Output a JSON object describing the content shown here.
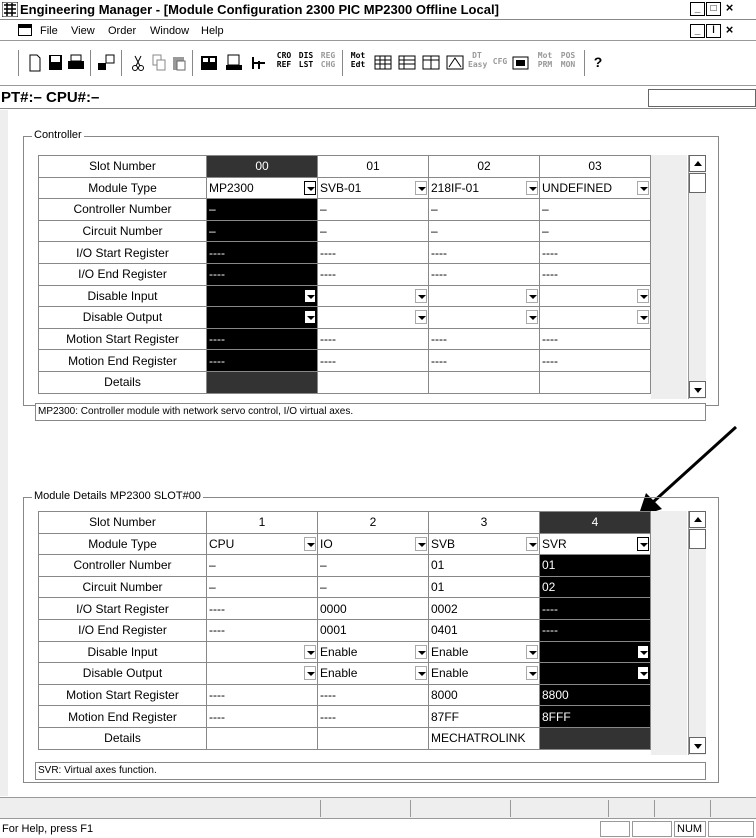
{
  "window": {
    "title": "Engineering Manager - [Module Configuration   2300 PIC MP2300   Offline Local]",
    "min_glyph": "_",
    "restore_glyph": "□",
    "close_glyph": "×",
    "restore_child_glyph": "ǀ"
  },
  "menu": [
    "File",
    "View",
    "Order",
    "Window",
    "Help"
  ],
  "toolbar": {
    "icons": [
      "new-doc-icon",
      "save-icon",
      "print-icon",
      "transfer-icon",
      "cut-icon",
      "copy-icon",
      "paste-icon",
      "module-icon",
      "register-icon",
      "ladder-icon",
      "cro-ref-icon",
      "dis-lst-icon",
      "reg-chg-icon",
      "mot-edt-icon",
      "mot-table-icon",
      "mot-table2-icon",
      "mot-int-icon",
      "pos-icon",
      "dt-easy-icon",
      "cfg-icon",
      "config-icon",
      "mot-prm-icon",
      "pos-mon-icon",
      "help-icon"
    ],
    "labels": {
      "cro_ref": "CRO REF",
      "dis_lst": "DIS LST",
      "reg_chg": "REG CHG",
      "mot_edt": "Mot Edt",
      "dt_easy": "DT Easy",
      "cfg": "CFG",
      "mot_prm": "Mot PRM",
      "pos_mon": "POS MON",
      "help": "?"
    }
  },
  "pt_label": "PT#:– CPU#:–",
  "controller": {
    "group_title": "Controller",
    "row_labels": [
      "Slot Number",
      "Module Type",
      "Controller Number",
      "Circuit Number",
      "I/O Start Register",
      "I/O End Register",
      "Disable Input",
      "Disable Output",
      "Motion Start Register",
      "Motion End Register",
      "Details"
    ],
    "columns": [
      {
        "slot": "00",
        "type": "MP2300",
        "ctrl": "–",
        "circ": "–",
        "io_start": "----",
        "io_end": "----",
        "dis_in": "",
        "dis_out": "",
        "mot_start": "----",
        "mot_end": "----",
        "details": ""
      },
      {
        "slot": "01",
        "type": "SVB-01",
        "ctrl": "–",
        "circ": "–",
        "io_start": "----",
        "io_end": "----",
        "dis_in": "",
        "dis_out": "",
        "mot_start": "----",
        "mot_end": "----",
        "details": ""
      },
      {
        "slot": "02",
        "type": "218IF-01",
        "ctrl": "–",
        "circ": "–",
        "io_start": "----",
        "io_end": "----",
        "dis_in": "",
        "dis_out": "",
        "mot_start": "----",
        "mot_end": "----",
        "details": ""
      },
      {
        "slot": "03",
        "type": "UNDEFINED",
        "ctrl": "–",
        "circ": "–",
        "io_start": "----",
        "io_end": "----",
        "dis_in": "",
        "dis_out": "",
        "mot_start": "----",
        "mot_end": "----",
        "details": ""
      }
    ],
    "description": "MP2300: Controller module with network servo control, I/O virtual axes."
  },
  "module_details": {
    "group_title": "Module Details  MP2300  SLOT#00",
    "row_labels": [
      "Slot Number",
      "Module Type",
      "Controller Number",
      "Circuit Number",
      "I/O Start Register",
      "I/O End Register",
      "Disable Input",
      "Disable Output",
      "Motion Start Register",
      "Motion End Register",
      "Details"
    ],
    "columns": [
      {
        "slot": "1",
        "type": "CPU",
        "ctrl": "–",
        "circ": "–",
        "io_start": "----",
        "io_end": "----",
        "dis_in": "",
        "dis_out": "",
        "mot_start": "----",
        "mot_end": "----",
        "details": ""
      },
      {
        "slot": "2",
        "type": "IO",
        "ctrl": "–",
        "circ": "–",
        "io_start": "0000",
        "io_end": "0001",
        "dis_in": "Enable",
        "dis_out": "Enable",
        "mot_start": "----",
        "mot_end": "----",
        "details": ""
      },
      {
        "slot": "3",
        "type": "SVB",
        "ctrl": "01",
        "circ": "01",
        "io_start": "0002",
        "io_end": "0401",
        "dis_in": "Enable",
        "dis_out": "Enable",
        "mot_start": "8000",
        "mot_end": "87FF",
        "details": "MECHATROLINK"
      },
      {
        "slot": "4",
        "type": "SVR",
        "ctrl": "01",
        "circ": "02",
        "io_start": "----",
        "io_end": "----",
        "dis_in": "",
        "dis_out": "",
        "mot_start": "8800",
        "mot_end": "8FFF",
        "details": ""
      }
    ],
    "description": "SVR: Virtual axes function."
  },
  "status": {
    "help_text": "For Help, press F1",
    "num": "NUM"
  }
}
